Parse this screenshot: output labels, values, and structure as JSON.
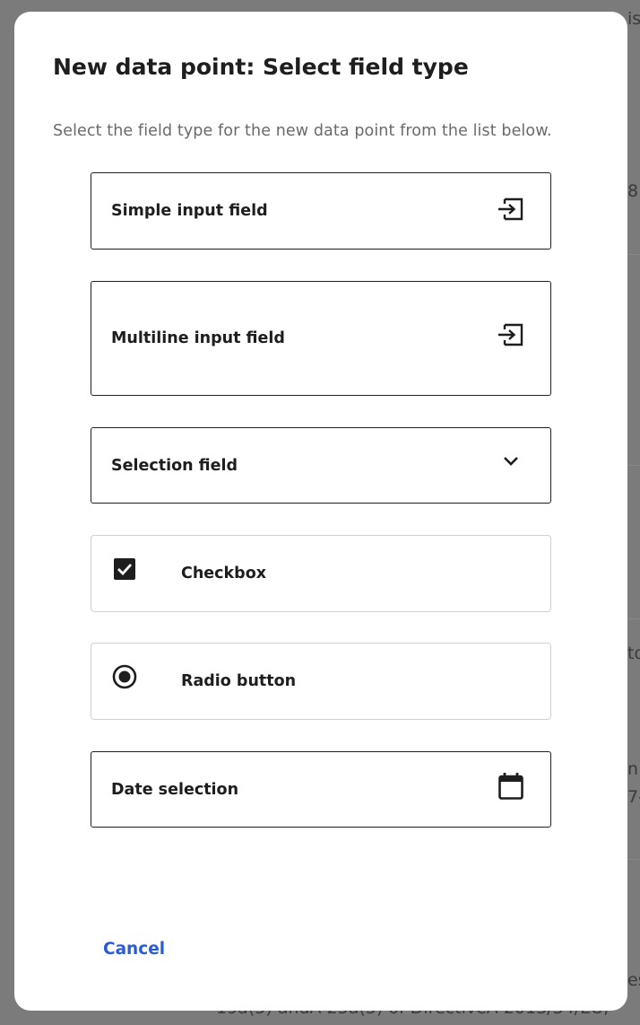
{
  "dialog": {
    "title": "New data point: Select field type",
    "description": "Select the field type for the new data point from the list below.",
    "cancel_label": "Cancel"
  },
  "options": [
    {
      "label": "Simple input field",
      "icon": "input-icon"
    },
    {
      "label": "Multiline input field",
      "icon": "input-icon"
    },
    {
      "label": "Selection field",
      "icon": "chevron-down-icon"
    },
    {
      "label": "Checkbox",
      "icon": "checkbox-checked-icon"
    },
    {
      "label": "Radio button",
      "icon": "radio-selected-icon"
    },
    {
      "label": "Date selection",
      "icon": "calendar-icon"
    }
  ],
  "background": {
    "fragments": [
      "is",
      "8",
      "to",
      "n",
      "7-",
      "es",
      "19a(5) andA 25a(5) of DirectiveA 2013/34/EU,"
    ]
  },
  "colors": {
    "accent": "#2a5bd7",
    "text": "#1e1e1e",
    "muted": "#6a6a6a",
    "overlay": "#7b7b7b"
  }
}
